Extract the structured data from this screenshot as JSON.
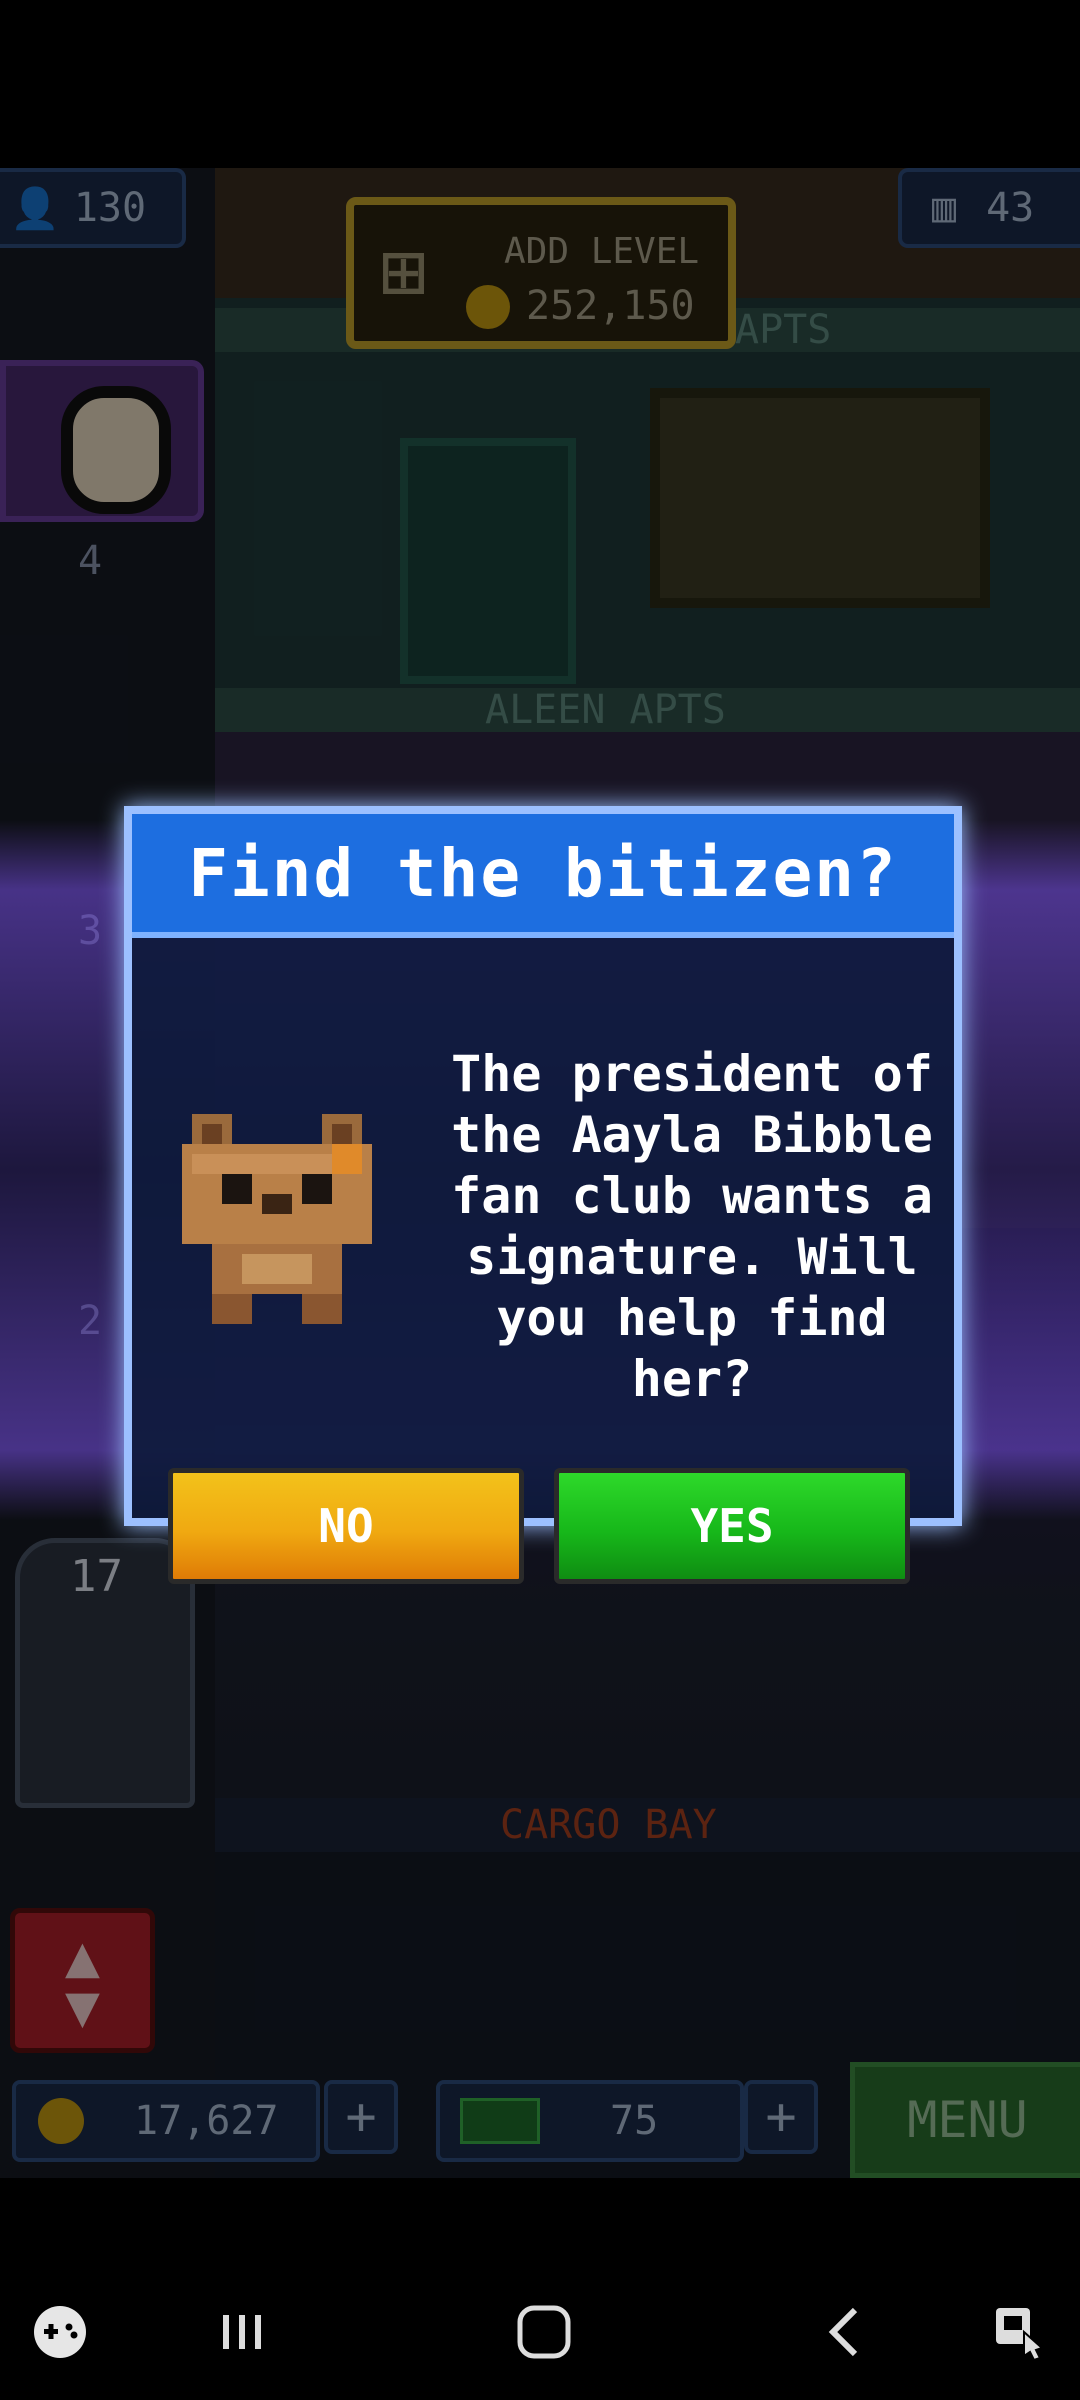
{
  "top_hud": {
    "population": "130",
    "floors": "43",
    "add_level_label": "ADD LEVEL",
    "add_level_cost": "252,150"
  },
  "floor_labels": {
    "upper_partial": "APTS",
    "aleen": "ALEEN APTS",
    "cargo": "CARGO BAY"
  },
  "elevator": {
    "floor_4": "4",
    "floor_3": "3",
    "floor_2": "2",
    "current": "17"
  },
  "dialog": {
    "title": "Find the bitizen?",
    "message": "The president of the Aayla Bibble fan club wants a signature. Will you help find her?",
    "no_label": "NO",
    "yes_label": "YES"
  },
  "bottom_hud": {
    "coins": "17,627",
    "bux": "75",
    "menu_label": "MENU"
  },
  "colors": {
    "dialog_title_bg": "#1d6ee0",
    "no_button": "#f0a911",
    "yes_button": "#17b81a"
  }
}
